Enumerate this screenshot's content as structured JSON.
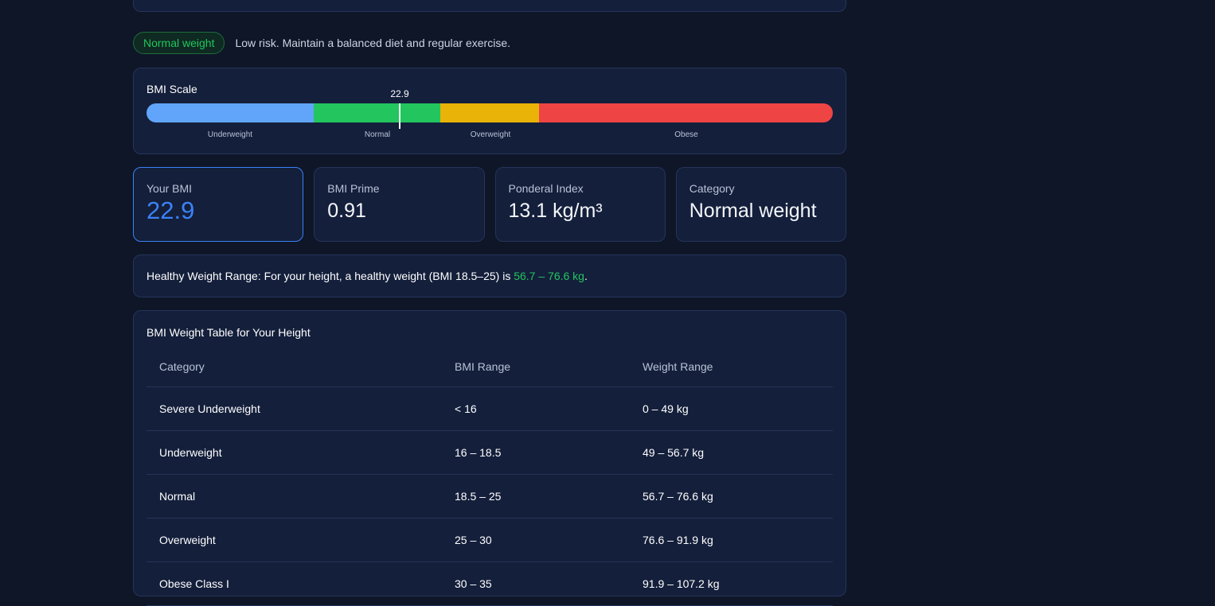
{
  "status": {
    "badge": "Normal weight",
    "message": "Low risk. Maintain a balanced diet and regular exercise."
  },
  "scale": {
    "title": "BMI Scale",
    "marker_value": "22.9",
    "segments": [
      {
        "label": "Underweight",
        "color": "#60a5fa"
      },
      {
        "label": "Normal",
        "color": "#22c55e"
      },
      {
        "label": "Overweight",
        "color": "#eab308"
      },
      {
        "label": "Obese",
        "color": "#ef4444"
      }
    ]
  },
  "stats": [
    {
      "label": "Your BMI",
      "value": "22.9"
    },
    {
      "label": "BMI Prime",
      "value": "0.91"
    },
    {
      "label": "Ponderal Index",
      "value": "13.1 kg/m³"
    },
    {
      "label": "Category",
      "value": "Normal weight"
    }
  ],
  "healthy_range": {
    "prefix": "Healthy Weight Range: For your height, a healthy weight (BMI 18.5–25) is",
    "value": "56.7 – 76.6 kg",
    "suffix": "."
  },
  "table": {
    "title": "BMI Weight Table for Your Height",
    "headers": [
      "Category",
      "BMI Range",
      "Weight Range"
    ],
    "rows": [
      [
        "Severe Underweight",
        "< 16",
        "0 – 49 kg"
      ],
      [
        "Underweight",
        "16 – 18.5",
        "49 – 56.7 kg"
      ],
      [
        "Normal",
        "18.5 – 25",
        "56.7 – 76.6 kg"
      ],
      [
        "Overweight",
        "25 – 30",
        "76.6 – 91.9 kg"
      ],
      [
        "Obese Class I",
        "30 – 35",
        "91.9 – 107.2 kg"
      ]
    ]
  },
  "colors": {
    "accent": "#3b82f6",
    "good": "#22c55e"
  }
}
